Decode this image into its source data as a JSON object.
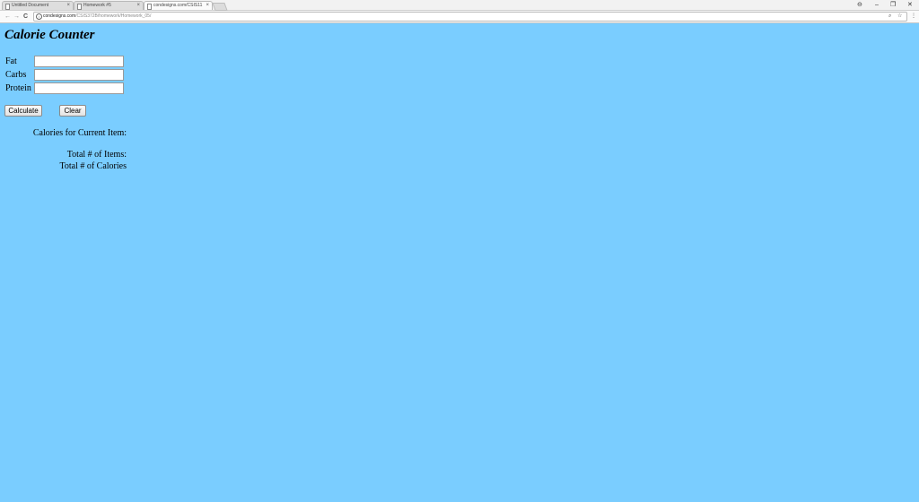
{
  "browser": {
    "tabs": [
      {
        "title": "Untitled Document",
        "active": false
      },
      {
        "title": "Homework #5",
        "active": false
      },
      {
        "title": "condesigns.com/CSIS11",
        "active": true
      }
    ],
    "close_glyph": "×",
    "url": {
      "domain": "condesigns.com",
      "path": "/CSIS372B/homework/Homework_05/"
    },
    "window_controls": {
      "account": "⊖",
      "minimize": "–",
      "restore": "❐",
      "close": "✕"
    },
    "nav": {
      "back": "←",
      "forward": "→",
      "reload": "C"
    },
    "icons": {
      "zoom": "⌕",
      "star": "☆",
      "menu": "⋮"
    }
  },
  "page": {
    "title": "Calorie Counter",
    "background": "#7acdff",
    "fields": [
      {
        "label": "Fat",
        "value": ""
      },
      {
        "label": "Carbs",
        "value": ""
      },
      {
        "label": "Protein",
        "value": ""
      }
    ],
    "buttons": {
      "calculate": "Calculate",
      "clear": "Clear"
    },
    "results": {
      "current_item": "Calories for Current Item:",
      "total_items": "Total # of Items:",
      "total_calories": "Total # of Calories"
    }
  }
}
